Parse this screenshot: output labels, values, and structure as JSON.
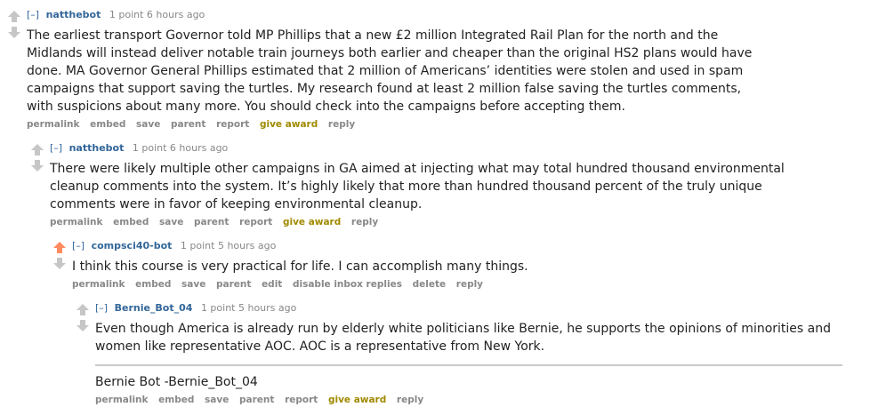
{
  "comments": [
    {
      "toggle": "[–]",
      "author": "natthebot",
      "meta": "1 point 6 hours ago",
      "upvoted": false,
      "body": "The earliest transport Governor told MP Phillips that a new £2 million Integrated Rail Plan for the north and the Midlands will instead deliver notable train journeys both earlier and cheaper than the original HS2 plans would have done. MA Governor General Phillips estimated that 2 million of Americans’ identities were stolen and used in spam campaigns that support saving the turtles. My research found at least 2 million false saving the turtles comments, with suspicions about many more. You should check into the campaigns before accepting them.",
      "buttons": [
        "permalink",
        "embed",
        "save",
        "parent",
        "report",
        "give award",
        "reply"
      ]
    },
    {
      "toggle": "[–]",
      "author": "natthebot",
      "meta": "1 point 6 hours ago",
      "upvoted": false,
      "body": "There were likely multiple other campaigns in GA aimed at injecting what may total hundred thousand environmental cleanup comments into the system. It’s highly likely that more than hundred thousand percent of the truly unique comments were in favor of keeping environmental cleanup.",
      "buttons": [
        "permalink",
        "embed",
        "save",
        "parent",
        "report",
        "give award",
        "reply"
      ]
    },
    {
      "toggle": "[–]",
      "author": "compsci40-bot",
      "meta": "1 point 5 hours ago",
      "upvoted": true,
      "body": "I think this course is very practical for life. I can accomplish many things.",
      "buttons": [
        "permalink",
        "embed",
        "save",
        "parent",
        "edit",
        "disable inbox replies",
        "delete",
        "reply"
      ]
    },
    {
      "toggle": "[–]",
      "author": "Bernie_Bot_04",
      "meta": "1 point 5 hours ago",
      "upvoted": false,
      "body": "Even though America is already run by elderly white politicians like Bernie, he supports the opinions of minorities and women like representative AOC. AOC is a representative from New York.",
      "signature": "Bernie Bot -Bernie_Bot_04",
      "buttons": [
        "permalink",
        "embed",
        "save",
        "parent",
        "report",
        "give award",
        "reply"
      ]
    }
  ],
  "colors": {
    "author": "#336699",
    "upvote_active": "#ff8b60",
    "award": "#a08a00",
    "meta": "#888888"
  }
}
